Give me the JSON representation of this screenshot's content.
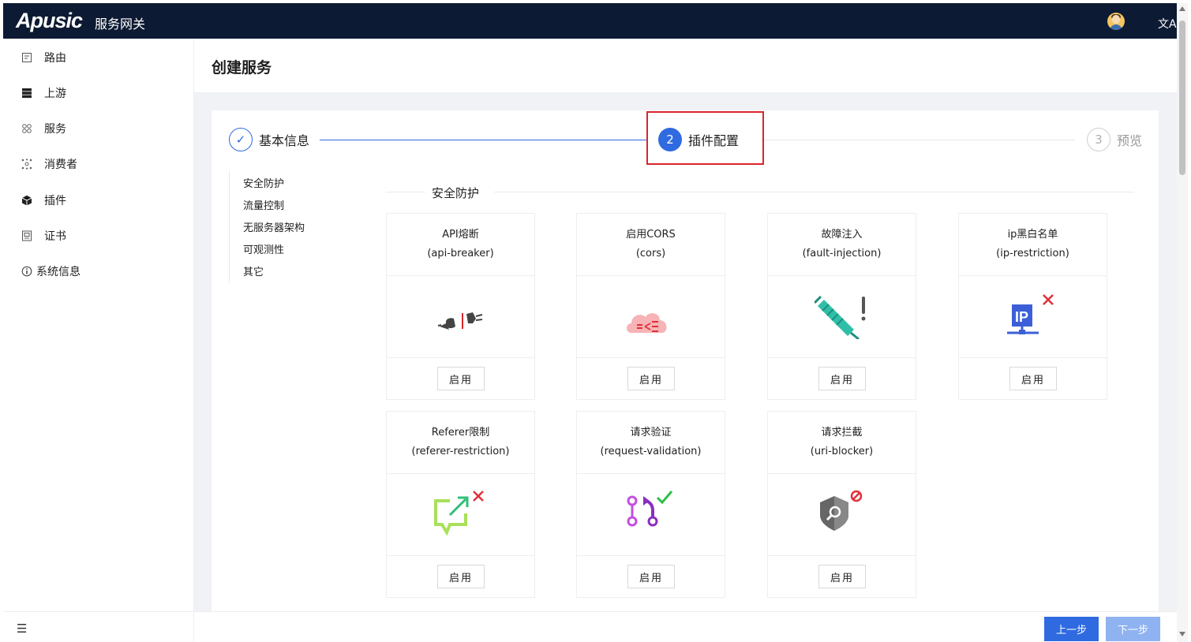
{
  "topbar": {
    "logo": "Apusic",
    "product_name": "服务网关",
    "translate_icon": "文A",
    "avatar_icon": "user-avatar"
  },
  "sidebar": {
    "items": [
      {
        "label": "路由",
        "icon": "route-icon"
      },
      {
        "label": "上游",
        "icon": "server-icon"
      },
      {
        "label": "服务",
        "icon": "service-icon"
      },
      {
        "label": "消费者",
        "icon": "consumer-icon"
      },
      {
        "label": "插件",
        "icon": "plugin-cube-icon"
      },
      {
        "label": "证书",
        "icon": "certificate-icon"
      },
      {
        "label": "系统信息",
        "icon": "info-icon"
      }
    ],
    "collapse_icon": "☰"
  },
  "page": {
    "title": "创建服务"
  },
  "steps": [
    {
      "number": "✓",
      "label": "基本信息",
      "status": "finished"
    },
    {
      "number": "2",
      "label": "插件配置",
      "status": "active"
    },
    {
      "number": "3",
      "label": "预览",
      "status": "waiting"
    }
  ],
  "subnav": [
    "安全防护",
    "流量控制",
    "无服务器架构",
    "可观测性",
    "其它"
  ],
  "section": {
    "title": "安全防护"
  },
  "plugins": [
    {
      "name": "API熔断",
      "id": "(api-breaker)",
      "button": "启用",
      "icon": "plug-icon"
    },
    {
      "name": "启用CORS",
      "id": "(cors)",
      "button": "启用",
      "icon": "cloud-cors-icon"
    },
    {
      "name": "故障注入",
      "id": "(fault-injection)",
      "button": "启用",
      "icon": "syringe-icon"
    },
    {
      "name": "ip黑白名单",
      "id": "(ip-restriction)",
      "button": "启用",
      "icon": "ip-network-icon"
    },
    {
      "name": "Referer限制",
      "id": "(referer-restriction)",
      "button": "启用",
      "icon": "referer-link-icon"
    },
    {
      "name": "请求验证",
      "id": "(request-validation)",
      "button": "启用",
      "icon": "merge-check-icon"
    },
    {
      "name": "请求拦截",
      "id": "(uri-blocker)",
      "button": "启用",
      "icon": "shield-search-icon"
    }
  ],
  "footer": {
    "prev": "上一步",
    "next": "下一步"
  },
  "colors": {
    "topbar": "#0d1a33",
    "primary": "#2f6ae0",
    "highlight_box": "#d9262c"
  }
}
